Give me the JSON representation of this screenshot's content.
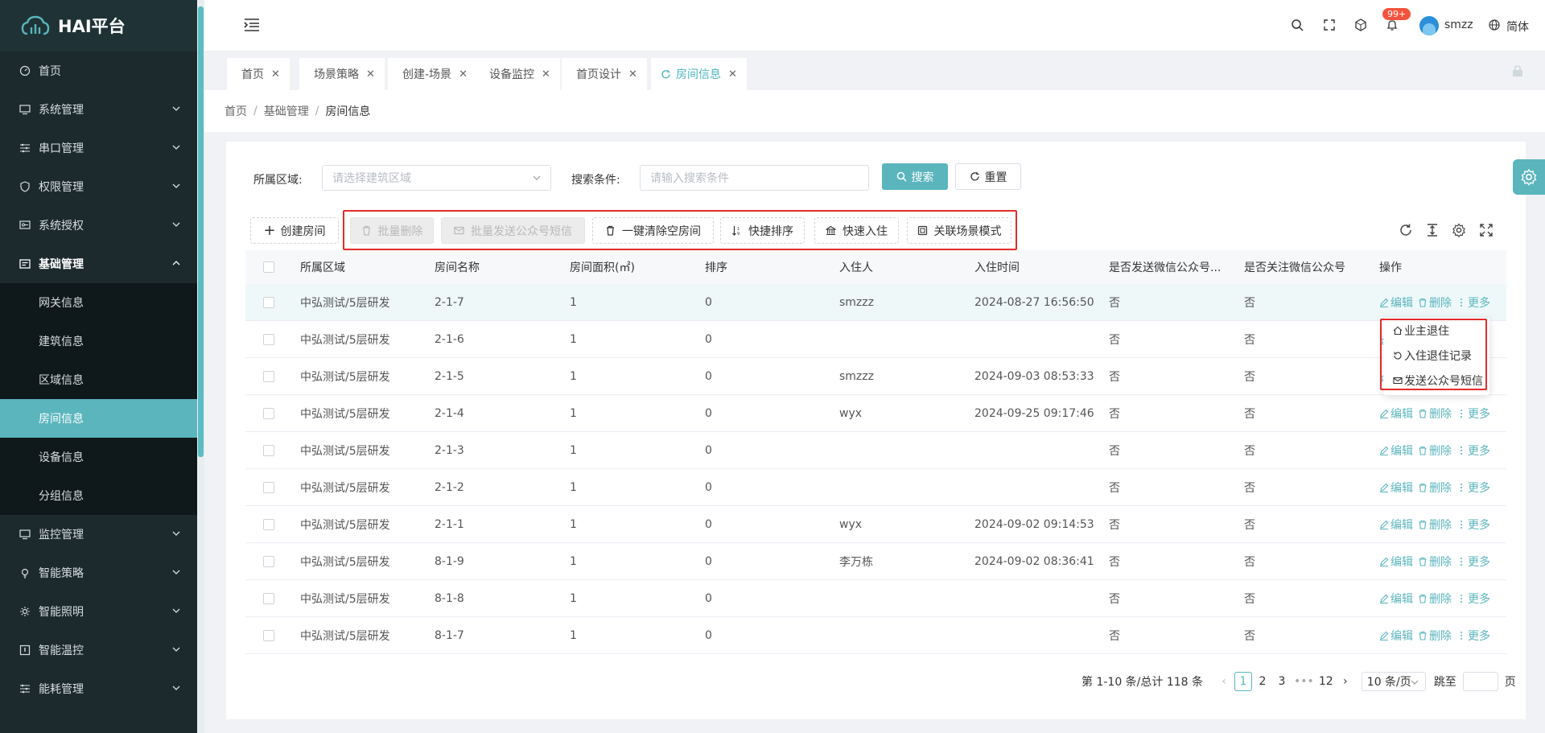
{
  "app": {
    "name": "HAI平台"
  },
  "sidebar": {
    "items": [
      {
        "label": "首页",
        "icon": "dashboard-icon"
      },
      {
        "label": "系统管理",
        "icon": "monitor-icon"
      },
      {
        "label": "串口管理",
        "icon": "sliders-icon"
      },
      {
        "label": "权限管理",
        "icon": "shield-icon"
      },
      {
        "label": "系统授权",
        "icon": "key-icon"
      },
      {
        "label": "基础管理",
        "icon": "card-icon"
      }
    ],
    "submenu": [
      {
        "label": "网关信息"
      },
      {
        "label": "建筑信息"
      },
      {
        "label": "区域信息"
      },
      {
        "label": "房间信息"
      },
      {
        "label": "设备信息"
      },
      {
        "label": "分组信息"
      }
    ],
    "items_after": [
      {
        "label": "监控管理",
        "icon": "monitor-icon"
      },
      {
        "label": "智能策略",
        "icon": "bulb-icon"
      },
      {
        "label": "智能照明",
        "icon": "sun-icon"
      },
      {
        "label": "智能温控",
        "icon": "thermo-icon"
      },
      {
        "label": "能耗管理",
        "icon": "sliders-icon"
      }
    ]
  },
  "header": {
    "notifications_badge": "99+",
    "username": "smzz",
    "language": "简体"
  },
  "tabs": [
    {
      "label": "首页"
    },
    {
      "label": "场景策略"
    },
    {
      "label": "创建-场景"
    },
    {
      "label": "设备监控"
    },
    {
      "label": "首页设计"
    },
    {
      "label": "房间信息"
    }
  ],
  "breadcrumb": [
    "首页",
    "基础管理",
    "房间信息"
  ],
  "filters": {
    "area_label": "所属区域:",
    "area_placeholder": "请选择建筑区域",
    "cond_label": "搜索条件:",
    "cond_placeholder": "请输入搜索条件",
    "search_btn": "搜索",
    "reset_btn": "重置"
  },
  "toolbar": {
    "create": "创建房间",
    "batch_delete": "批量删除",
    "batch_sms": "批量发送公众号短信",
    "clear_rooms": "一键清除空房间",
    "quick_sort": "快捷排序",
    "quick_checkin": "快速入住",
    "link_scene": "关联场景模式"
  },
  "table": {
    "headers": [
      "所属区域",
      "房间名称",
      "房间面积(㎡)",
      "排序",
      "入住人",
      "入住时间",
      "是否发送微信公众号...",
      "是否关注微信公众号",
      "操作"
    ],
    "rows": [
      [
        "中弘测试/5层研发",
        "2-1-7",
        "1",
        "0",
        "smzzz",
        "2024-08-27 16:56:50",
        "否",
        "否"
      ],
      [
        "中弘测试/5层研发",
        "2-1-6",
        "1",
        "0",
        "",
        "",
        "否",
        "否"
      ],
      [
        "中弘测试/5层研发",
        "2-1-5",
        "1",
        "0",
        "smzzz",
        "2024-09-03 08:53:33",
        "否",
        "否"
      ],
      [
        "中弘测试/5层研发",
        "2-1-4",
        "1",
        "0",
        "wyx",
        "2024-09-25 09:17:46",
        "否",
        "否"
      ],
      [
        "中弘测试/5层研发",
        "2-1-3",
        "1",
        "0",
        "",
        "",
        "否",
        "否"
      ],
      [
        "中弘测试/5层研发",
        "2-1-2",
        "1",
        "0",
        "",
        "",
        "否",
        "否"
      ],
      [
        "中弘测试/5层研发",
        "2-1-1",
        "1",
        "0",
        "wyx",
        "2024-09-02 09:14:53",
        "否",
        "否"
      ],
      [
        "中弘测试/5层研发",
        "8-1-9",
        "1",
        "0",
        "李万栋",
        "2024-09-02 08:36:41",
        "否",
        "否"
      ],
      [
        "中弘测试/5层研发",
        "8-1-8",
        "1",
        "0",
        "",
        "",
        "否",
        "否"
      ],
      [
        "中弘测试/5层研发",
        "8-1-7",
        "1",
        "0",
        "",
        "",
        "否",
        "否"
      ]
    ],
    "op_edit": "编辑",
    "op_delete": "删除",
    "op_more": "更多"
  },
  "more_menu": [
    "业主退住",
    "入住退住记录",
    "发送公众号短信"
  ],
  "pagination": {
    "summary": "第 1-10 条/总计 118 条",
    "pages": [
      "1",
      "2",
      "3",
      "•••",
      "12"
    ],
    "page_size": "10 条/页",
    "jump_label": "跳至",
    "page_suffix": "页"
  },
  "colors": {
    "accent": "#5ab5bd",
    "sidebar": "#1c2a2e",
    "highlight": "#e52b2b"
  }
}
